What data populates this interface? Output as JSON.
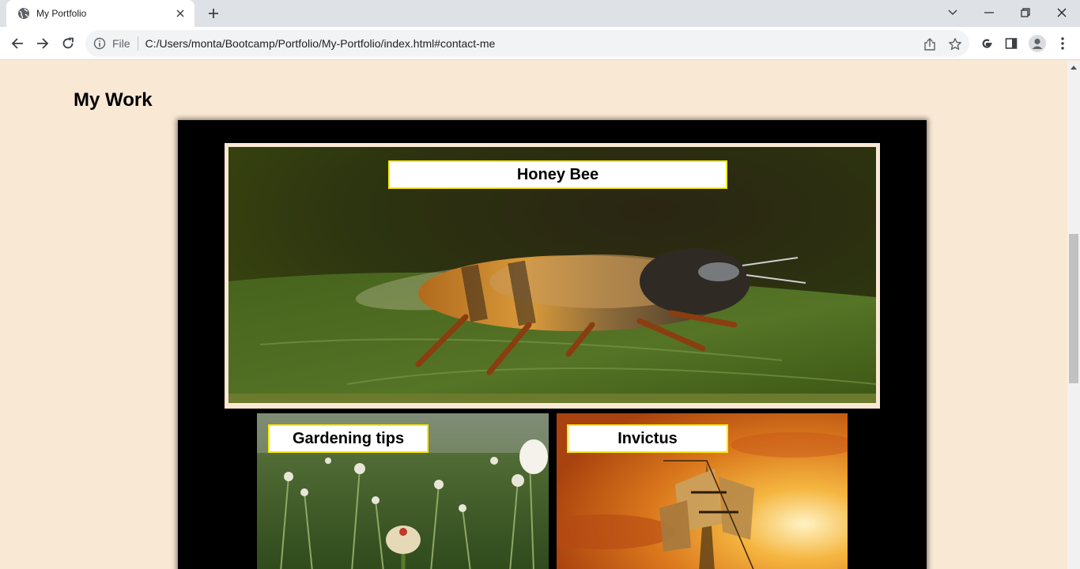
{
  "browser": {
    "tab_title": "My Portfolio",
    "omnibox_scheme": "File",
    "url": "C:/Users/monta/Bootcamp/Portfolio/My-Portfolio/index.html#contact-me",
    "icons": {
      "favicon": "globe-icon",
      "close": "close-icon",
      "new_tab": "plus-icon",
      "back": "arrow-left-icon",
      "forward": "arrow-right-icon",
      "reload": "reload-icon",
      "info": "info-icon",
      "share": "share-icon",
      "bookmark": "star-icon",
      "google": "google-icon",
      "side_panel": "side-panel-icon",
      "profile": "avatar-icon",
      "menu": "kebab-menu-icon"
    }
  },
  "page": {
    "section_title": "My Work",
    "projects": [
      {
        "title": "Honey Bee"
      },
      {
        "title": "Gardening tips"
      },
      {
        "title": "Invictus"
      }
    ]
  },
  "colors": {
    "page_bg": "#f9e8d4",
    "box_bg": "#000000",
    "label_border": "#ffeb00"
  }
}
